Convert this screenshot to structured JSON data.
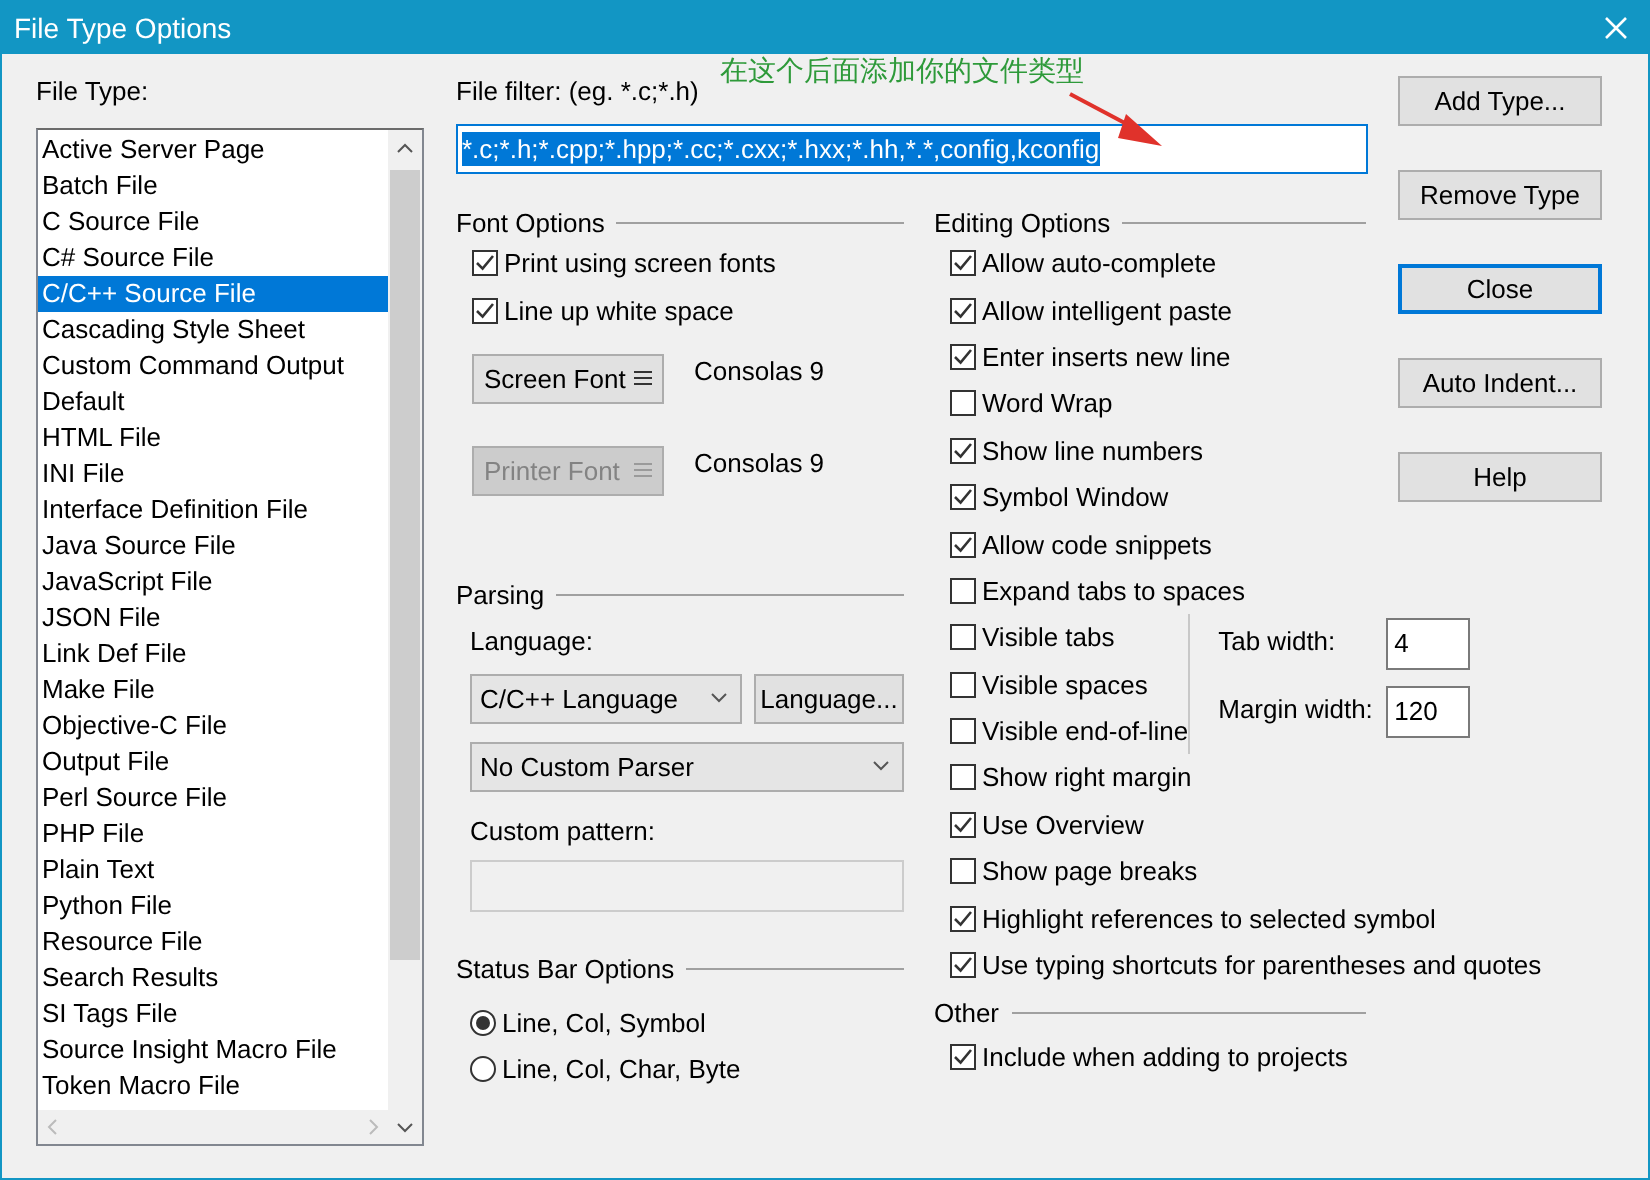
{
  "window": {
    "title": "File Type Options"
  },
  "annotation": {
    "text": "在这个后面添加你的文件类型"
  },
  "file_types": {
    "label": "File Type:",
    "items": [
      {
        "label": "Active Server Page",
        "selected": false
      },
      {
        "label": "Batch File",
        "selected": false
      },
      {
        "label": "C Source File",
        "selected": false
      },
      {
        "label": "C# Source File",
        "selected": false
      },
      {
        "label": "C/C++ Source File",
        "selected": true
      },
      {
        "label": "Cascading Style Sheet",
        "selected": false
      },
      {
        "label": "Custom Command Output",
        "selected": false
      },
      {
        "label": "Default",
        "selected": false
      },
      {
        "label": "HTML File",
        "selected": false
      },
      {
        "label": "INI File",
        "selected": false
      },
      {
        "label": "Interface Definition File",
        "selected": false
      },
      {
        "label": "Java Source File",
        "selected": false
      },
      {
        "label": "JavaScript File",
        "selected": false
      },
      {
        "label": "JSON File",
        "selected": false
      },
      {
        "label": "Link Def File",
        "selected": false
      },
      {
        "label": "Make File",
        "selected": false
      },
      {
        "label": "Objective-C File",
        "selected": false
      },
      {
        "label": "Output File",
        "selected": false
      },
      {
        "label": "Perl Source File",
        "selected": false
      },
      {
        "label": "PHP File",
        "selected": false
      },
      {
        "label": "Plain Text",
        "selected": false
      },
      {
        "label": "Python File",
        "selected": false
      },
      {
        "label": "Resource File",
        "selected": false
      },
      {
        "label": "Search Results",
        "selected": false
      },
      {
        "label": "SI Tags File",
        "selected": false
      },
      {
        "label": "Source Insight Macro File",
        "selected": false
      },
      {
        "label": "Token Macro File",
        "selected": false
      }
    ]
  },
  "file_filter": {
    "label": "File filter: (eg. *.c;*.h)",
    "value": "*.c;*.h;*.cpp;*.hpp;*.cc;*.cxx;*.hxx;*.hh,*.*,config,kconfig"
  },
  "font_options": {
    "heading": "Font Options",
    "checkboxes": [
      {
        "label": "Print using screen fonts",
        "checked": true
      },
      {
        "label": "Line up white space",
        "checked": true
      }
    ],
    "fonts": [
      {
        "button": "Screen Font",
        "disabled": false,
        "value": "Consolas 9"
      },
      {
        "button": "Printer Font",
        "disabled": true,
        "value": "Consolas 9"
      }
    ]
  },
  "parsing": {
    "heading": "Parsing",
    "language_label": "Language:",
    "language": "C/C++ Language",
    "language_button": "Language...",
    "parser": "No Custom Parser",
    "pattern_label": "Custom pattern:"
  },
  "status_bar_options": {
    "heading": "Status Bar Options",
    "options": [
      {
        "label": "Line, Col, Symbol",
        "selected": true
      },
      {
        "label": "Line, Col, Char, Byte",
        "selected": false
      }
    ]
  },
  "editing_options": {
    "heading": "Editing Options",
    "checkboxes_top": [
      {
        "label": "Allow auto-complete",
        "checked": true
      },
      {
        "label": "Allow intelligent paste",
        "checked": true
      },
      {
        "label": "Enter inserts new line",
        "checked": true
      },
      {
        "label": "Word Wrap",
        "checked": false
      },
      {
        "label": "Show line numbers",
        "checked": true
      },
      {
        "label": "Symbol Window",
        "checked": true
      },
      {
        "label": "Allow code snippets",
        "checked": true
      },
      {
        "label": "Expand tabs to spaces",
        "checked": false
      }
    ],
    "checkboxes_side": [
      {
        "label": "Visible tabs",
        "checked": false
      },
      {
        "label": "Visible spaces",
        "checked": false
      },
      {
        "label": "Visible end-of-line",
        "checked": false
      }
    ],
    "fields": [
      {
        "label": "Tab width:",
        "value": "4"
      },
      {
        "label": "Margin width:",
        "value": "120"
      }
    ],
    "checkboxes_bottom": [
      {
        "label": "Show right margin",
        "checked": false
      },
      {
        "label": "Use Overview",
        "checked": true
      },
      {
        "label": "Show page breaks",
        "checked": false
      },
      {
        "label": "Highlight references to selected symbol",
        "checked": true
      },
      {
        "label": "Use typing shortcuts for parentheses and quotes",
        "checked": true
      }
    ]
  },
  "other": {
    "heading": "Other",
    "checkboxes": [
      {
        "label": "Include when adding to projects",
        "checked": true
      }
    ]
  },
  "buttons": [
    {
      "label": "Add Type...",
      "default": false
    },
    {
      "label": "Remove Type",
      "default": false
    },
    {
      "label": "Close",
      "default": true
    },
    {
      "label": "Auto Indent...",
      "default": false
    },
    {
      "label": "Help",
      "default": false
    }
  ]
}
